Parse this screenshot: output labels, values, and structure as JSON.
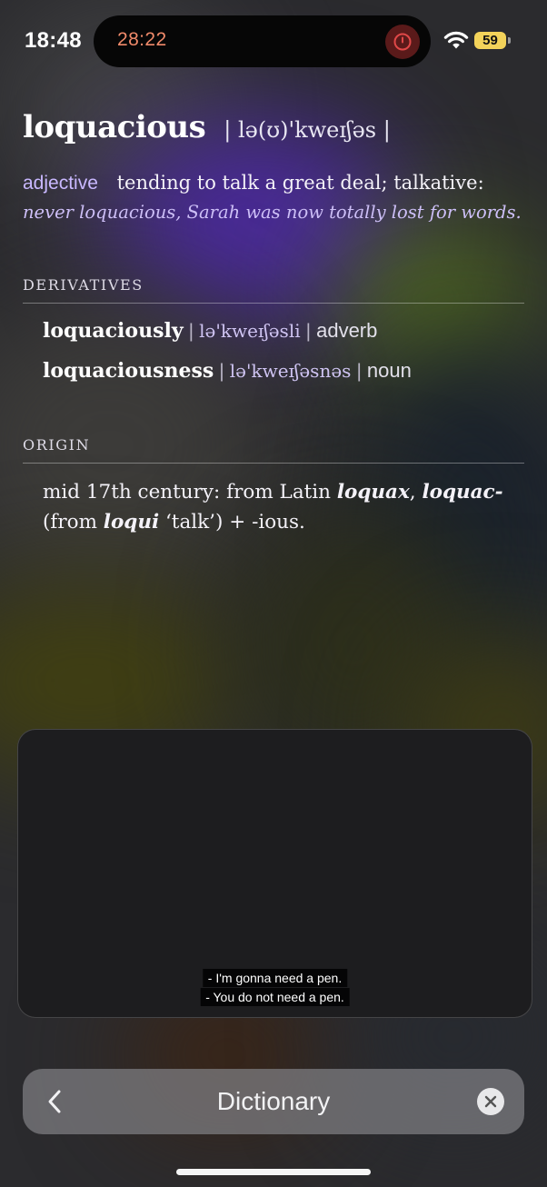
{
  "status_bar": {
    "time": "18:48",
    "battery": "59",
    "wifi_icon": "wifi-icon"
  },
  "dynamic_island": {
    "timer": "28:22",
    "stop_icon": "power-icon"
  },
  "entry": {
    "headword": "loquacious",
    "pronunciation": "| lə(ʊ)'kweɪʃəs |",
    "part_of_speech": "adjective",
    "definition": "tending to talk a great deal; talkative:",
    "example": "never loquacious, Sarah was now totally lost for words."
  },
  "derivatives": {
    "title": "DERIVATIVES",
    "items": [
      {
        "word": "loquaciously",
        "ipa": "lə'kweɪʃəsli",
        "pos": "adverb"
      },
      {
        "word": "loquaciousness",
        "ipa": "lə'kweɪʃəsnəs",
        "pos": "noun"
      }
    ],
    "separator": "|"
  },
  "origin": {
    "title": "ORIGIN",
    "t1": "mid 17th century: from Latin ",
    "b1": "loquax",
    "t2": ", ",
    "b2": "loquac-",
    "t3": "(from ",
    "b3": "loqui",
    "t4": " ‘talk’) + -ious."
  },
  "video": {
    "subtitle_1": "- I'm gonna need a pen.",
    "subtitle_2": "- You do not need a pen."
  },
  "search_bar": {
    "title": "Dictionary",
    "back_icon": "chevron-left-icon",
    "clear_icon": "close-circle-icon"
  }
}
